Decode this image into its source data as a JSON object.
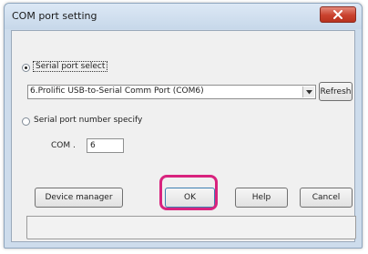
{
  "window": {
    "title": "COM port setting",
    "close_icon": "close-icon"
  },
  "serial_port_select": {
    "label": "Serial port select",
    "selected": true,
    "dropdown_value": "6.Prolific USB-to-Serial Comm Port (COM6)",
    "refresh_label": "Refresh"
  },
  "serial_port_number": {
    "label": "Serial port number specify",
    "selected": false,
    "com_label": "COM .",
    "com_value": "6"
  },
  "buttons": {
    "device_manager": "Device manager",
    "ok": "OK",
    "help": "Help",
    "cancel": "Cancel"
  },
  "status_bar": {
    "text": ""
  },
  "colors": {
    "highlight": "#d8237e",
    "close_button": "#c9422e"
  }
}
